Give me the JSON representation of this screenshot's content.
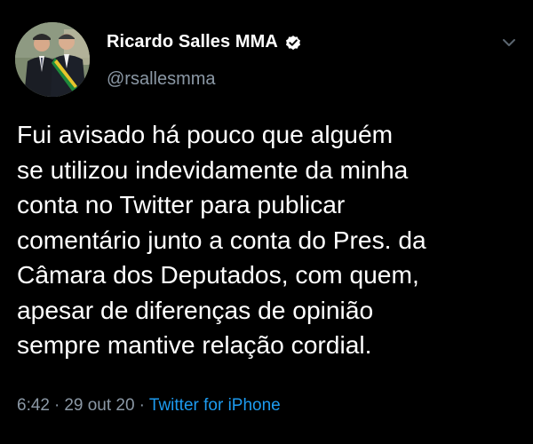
{
  "tweet": {
    "author": {
      "display_name": "Ricardo Salles MMA",
      "handle": "@rsallesmma",
      "verified": true,
      "avatar_icon": "profile-photo"
    },
    "menu_icon": "chevron-down-icon",
    "text": "Fui avisado há pouco que alguém\nse utilizou indevidamente da minha\nconta no Twitter para publicar\ncomentário junto a conta do Pres. da\nCâmara dos Deputados, com quem,\napesar de diferenças de opinião\nsempre mantive relação cordial.",
    "time": "6:42",
    "separator": "·",
    "date": "29 out 20",
    "source": "Twitter for iPhone"
  },
  "colors": {
    "background": "#000000",
    "text_primary": "#ffffff",
    "text_secondary": "#8b98a5",
    "link": "#1d9bf0",
    "verified_badge": "#ffffff"
  }
}
